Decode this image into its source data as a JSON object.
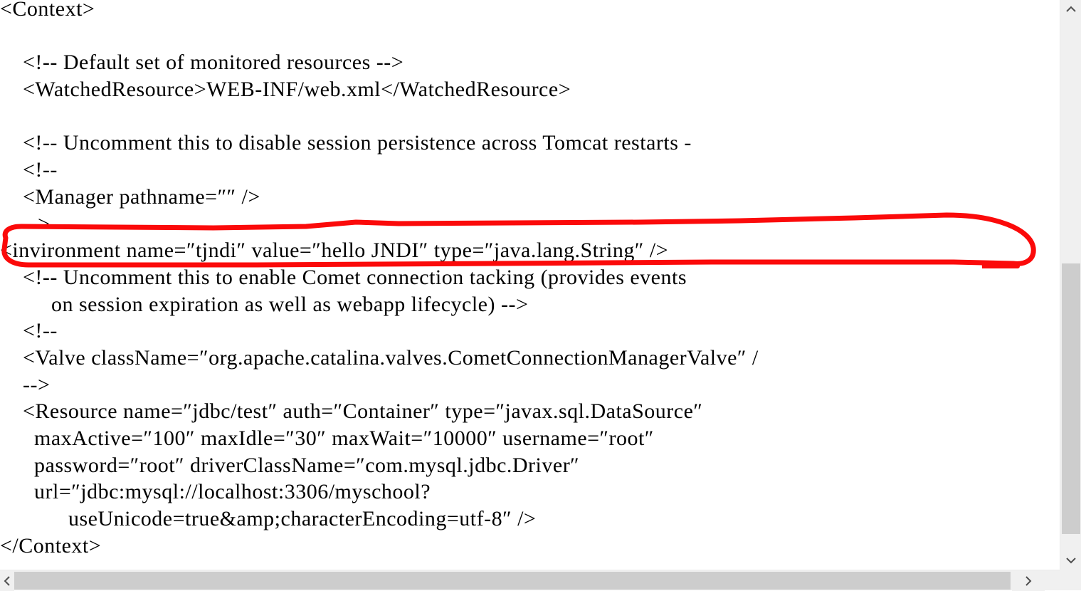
{
  "editor": {
    "language": "xml",
    "file_kind": "tomcat-context-configuration",
    "code_lines": [
      "<Context>",
      "",
      "    <!-- Default set of monitored resources -->",
      "    <WatchedResource>WEB-INF/web.xml</WatchedResource>",
      "",
      "    <!-- Uncomment this to disable session persistence across Tomcat restarts -",
      "    <!--",
      "    <Manager pathname=\"\" />",
      "    -->",
      "<invironment name=\"tjndi\" value=\"hello JNDI\" type=\"java.lang.String\" />",
      "    <!-- Uncomment this to enable Comet connection tacking (provides events",
      "         on session expiration as well as webapp lifecycle) -->",
      "    <!--",
      "    <Valve className=\"org.apache.catalina.valves.CometConnectionManagerValve\" /",
      "    -->",
      "    <Resource name=\"jdbc/test\" auth=\"Container\" type=\"javax.sql.DataSource\"",
      "      maxActive=\"100\" maxIdle=\"30\" maxWait=\"10000\" username=\"root\"",
      "      password=\"root\" driverClassName=\"com.mysql.jdbc.Driver\"",
      "      url=\"jdbc:mysql://localhost:3306/myschool?",
      "            useUnicode=true&amp;characterEncoding=utf-8\" />",
      "</Context>"
    ],
    "highlighted_line_index": 9,
    "highlighted_line_text": "<invironment name=\"tjndi\" value=\"hello JNDI\" type=\"java.lang.String\" />"
  },
  "annotation": {
    "kind": "hand-drawn-oval-highlight",
    "color": "#fb0a0a",
    "stroke_width": 7,
    "targets_line": "<invironment name=\"tjndi\" value=\"hello JNDI\" type=\"java.lang.String\" />"
  },
  "scrollbars": {
    "vertical": {
      "up_arrow": "▲",
      "down_arrow": "▼",
      "thumb_position_percent": 46,
      "thumb_size_percent": 48,
      "track_color": "#f0f0f0",
      "thumb_color": "#cdcdcd"
    },
    "horizontal": {
      "left_arrow": "◀",
      "right_arrow": "▶",
      "thumb_position_percent": 1,
      "thumb_size_percent": 94,
      "track_color": "#f0f0f0",
      "thumb_color": "#cdcdcd"
    }
  },
  "colors": {
    "background": "#ffffff",
    "text": "#000000",
    "annotation_red": "#fb0a0a",
    "scroll_track": "#f0f0f0",
    "scroll_thumb": "#cdcdcd",
    "scroll_arrow": "#505050"
  }
}
